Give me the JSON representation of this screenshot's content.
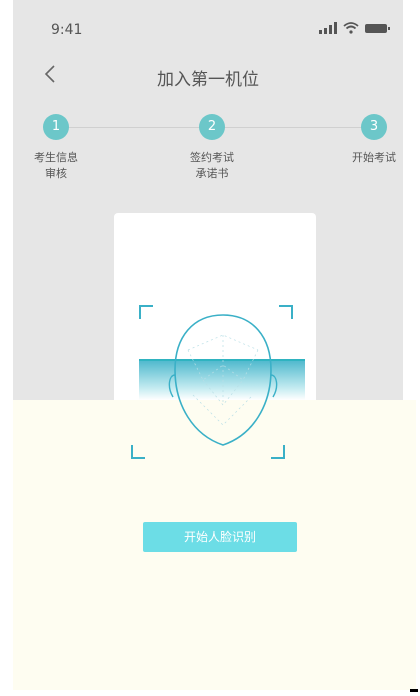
{
  "status_bar": {
    "time": "9:41",
    "icons": [
      "signal-icon",
      "wifi-icon",
      "battery-icon"
    ]
  },
  "nav": {
    "back_icon": "chevron-left-icon",
    "title": "加入第一机位"
  },
  "steps": [
    {
      "number": "1",
      "label": "考生信息\n审核"
    },
    {
      "number": "2",
      "label": "签约考试\n承诺书"
    },
    {
      "number": "3",
      "label": "开始考试"
    }
  ],
  "face_capture": {
    "icon": "face-scan-icon"
  },
  "actions": {
    "start_face_recognition": "开始人脸识别"
  },
  "colors": {
    "accent": "#6cc7c9",
    "button": "#6cdde6",
    "scan": "#3ab0c7",
    "background": "#e6e6e6",
    "panel": "#fefdf1"
  }
}
